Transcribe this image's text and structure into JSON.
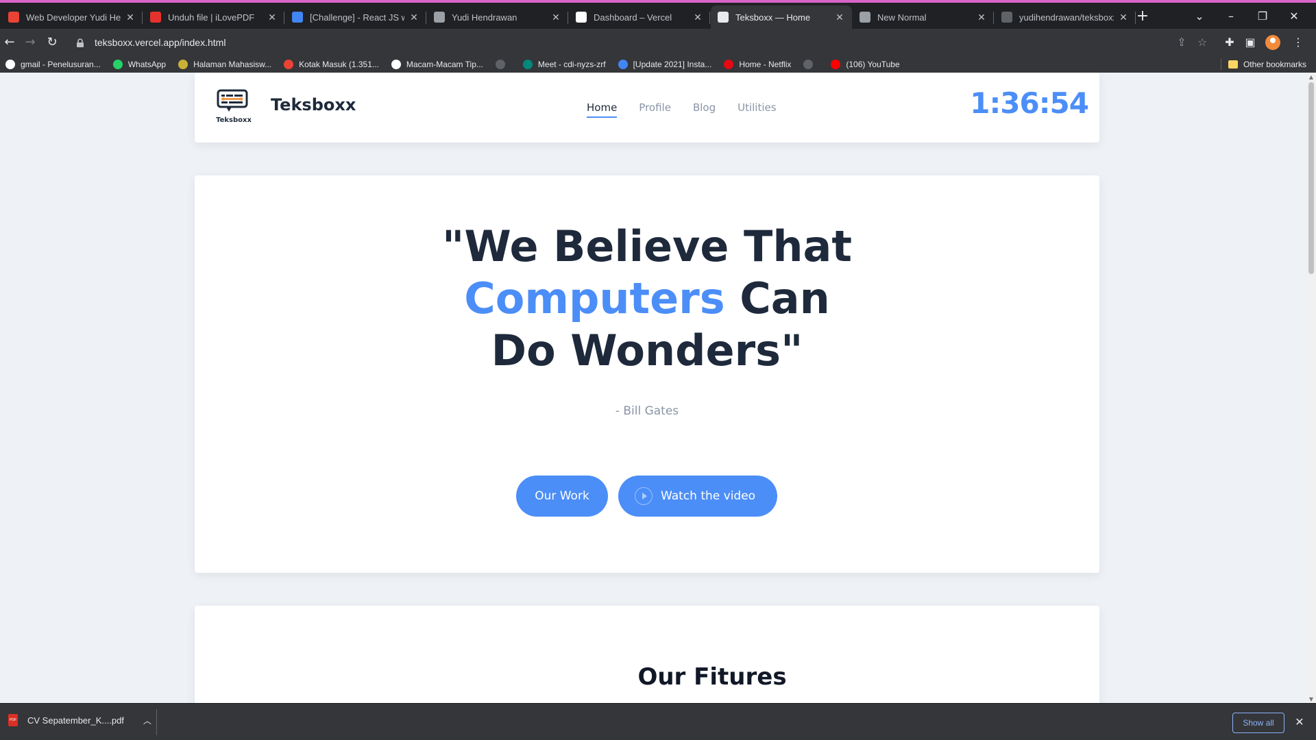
{
  "browser": {
    "tabs": [
      {
        "title": "Web Developer Yudi Hend",
        "favicon": "gmail-icon",
        "color": "#ea4335",
        "active": false
      },
      {
        "title": "Unduh file | iLovePDF",
        "favicon": "ilovepdf-icon",
        "color": "#e5322d",
        "active": false
      },
      {
        "title": "[Challenge] - React JS with",
        "favicon": "classroom-icon",
        "color": "#4285f4",
        "active": false
      },
      {
        "title": "Yudi Hendrawan",
        "favicon": "globe-icon",
        "color": "#9aa0a6",
        "active": false
      },
      {
        "title": "Dashboard – Vercel",
        "favicon": "vercel-icon",
        "color": "#ffffff",
        "active": false
      },
      {
        "title": "Teksboxx — Home",
        "favicon": "page-icon",
        "color": "#e8eaed",
        "active": true
      },
      {
        "title": "New Normal",
        "favicon": "globe-icon",
        "color": "#9aa0a6",
        "active": false
      },
      {
        "title": "yudihendrawan/teksboxx",
        "favicon": "github-icon",
        "color": "#5f6368",
        "active": false
      }
    ],
    "url": "teksboxx.vercel.app/index.html",
    "bookmarks": [
      {
        "label": "gmail - Penelusuran...",
        "icon": "google-icon",
        "color": "#ffffff"
      },
      {
        "label": "WhatsApp",
        "icon": "whatsapp-icon",
        "color": "#25d366"
      },
      {
        "label": "Halaman Mahasisw...",
        "icon": "campus-icon",
        "color": "#c9b037"
      },
      {
        "label": "Kotak Masuk (1.351...",
        "icon": "gmail-icon",
        "color": "#ea4335"
      },
      {
        "label": "Macam-Macam Tip...",
        "icon": "g-letter-icon",
        "color": "#ffffff"
      },
      {
        "label": "",
        "icon": "globe-icon",
        "color": "#5f6368"
      },
      {
        "label": "Meet - cdi-nyzs-zrf",
        "icon": "meet-icon",
        "color": "#00897b"
      },
      {
        "label": "[Update 2021] Insta...",
        "icon": "site-icon",
        "color": "#4285f4"
      },
      {
        "label": "Home - Netflix",
        "icon": "netflix-icon",
        "color": "#e50914"
      },
      {
        "label": "",
        "icon": "globe-icon",
        "color": "#5f6368"
      },
      {
        "label": "(106) YouTube",
        "icon": "youtube-icon",
        "color": "#ff0000"
      }
    ],
    "other_bookmarks": "Other bookmarks"
  },
  "site": {
    "brand": "Teksboxx",
    "logo_text": "Teksboxx",
    "nav": [
      {
        "label": "Home",
        "active": true
      },
      {
        "label": "Profile",
        "active": false
      },
      {
        "label": "Blog",
        "active": false
      },
      {
        "label": "Utilities",
        "active": false
      }
    ],
    "clock": "1:36:54",
    "accent_color": "#4c8ef7",
    "dark_color": "#1e2a3b"
  },
  "hero": {
    "quote_part1": "\"We Believe That",
    "quote_highlight": "Computers",
    "quote_part2": " Can",
    "quote_part3": "Do Wonders\"",
    "author": "- Bill Gates",
    "btn_work": "Our Work",
    "btn_video": "Watch the video"
  },
  "features": {
    "title": "Our Fitures"
  },
  "downloads": {
    "file": "CV Sepatember_K....pdf",
    "show_all": "Show all"
  }
}
